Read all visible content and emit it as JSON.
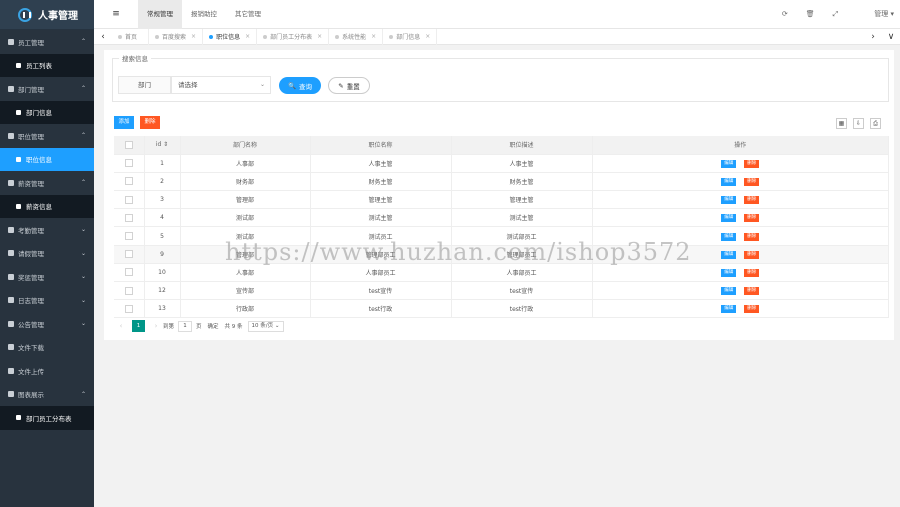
{
  "app": {
    "title": "人事管理"
  },
  "sidebar": {
    "items": [
      {
        "type": "group",
        "label": "员工管理",
        "icon": "users-icon",
        "chev": "^"
      },
      {
        "type": "sub",
        "label": "员工列表",
        "icon": "user-icon"
      },
      {
        "type": "group",
        "label": "部门管理",
        "icon": "org-icon",
        "chev": "^"
      },
      {
        "type": "sub",
        "label": "部门信息",
        "icon": "list-icon"
      },
      {
        "type": "group",
        "label": "职位管理",
        "icon": "bank-icon",
        "chev": "^"
      },
      {
        "type": "sub",
        "label": "职位信息",
        "icon": "list-icon",
        "active": true
      },
      {
        "type": "group",
        "label": "薪资管理",
        "icon": "money-icon",
        "chev": "^"
      },
      {
        "type": "sub",
        "label": "薪资信息",
        "icon": "list-icon"
      },
      {
        "type": "group",
        "label": "考勤管理",
        "icon": "car-icon",
        "chev": "v"
      },
      {
        "type": "group",
        "label": "请假管理",
        "icon": "bed-icon",
        "chev": "v"
      },
      {
        "type": "group",
        "label": "奖惩管理",
        "icon": "gear-icon",
        "chev": "v"
      },
      {
        "type": "group",
        "label": "日志管理",
        "icon": "gear-icon",
        "chev": "v"
      },
      {
        "type": "group",
        "label": "公告管理",
        "icon": "gear-icon",
        "chev": "v"
      },
      {
        "type": "group",
        "label": "文件下载",
        "icon": "cloud-download-icon",
        "chev": ""
      },
      {
        "type": "group",
        "label": "文件上传",
        "icon": "cloud-upload-icon",
        "chev": ""
      },
      {
        "type": "group",
        "label": "图表展示",
        "icon": "chart-icon",
        "chev": "^"
      },
      {
        "type": "sub",
        "label": "部门员工分布表",
        "icon": "bar-chart-icon"
      }
    ]
  },
  "topbar": {
    "toggle_icon": "≡",
    "menus": [
      "常规管理",
      "报销助控",
      "其它管理"
    ],
    "right": {
      "refresh": "⟳",
      "clear": "🗑",
      "fullscreen": "⤢",
      "user": "管理"
    }
  },
  "tabs": {
    "items": [
      {
        "label": "首页",
        "close": ""
      },
      {
        "label": "百度搜索",
        "close": "×"
      },
      {
        "label": "职位信息",
        "close": "×",
        "active": true
      },
      {
        "label": "部门员工分布表",
        "close": "×"
      },
      {
        "label": "系统性能",
        "close": "×"
      },
      {
        "label": "部门信息",
        "close": "×"
      }
    ],
    "left_arrow": "‹",
    "right_arrow": "›",
    "menu_arrow": "∨"
  },
  "search": {
    "legend": "搜索信息",
    "dept_label": "部门",
    "dept_placeholder": "请选择",
    "query_btn": "查询",
    "reset_btn": "重置"
  },
  "toolbar": {
    "add": "添加",
    "delete": "删除"
  },
  "table": {
    "headers": [
      "id ⇕",
      "部门名称",
      "职位名称",
      "职位描述",
      "操作"
    ],
    "edit_label": "编辑",
    "delete_label": "删除",
    "rows": [
      {
        "id": "1",
        "dept": "人事部",
        "pos": "人事主管",
        "desc": "人事主管"
      },
      {
        "id": "2",
        "dept": "财务部",
        "pos": "财务主管",
        "desc": "财务主管"
      },
      {
        "id": "3",
        "dept": "管理部",
        "pos": "管理主管",
        "desc": "管理主管"
      },
      {
        "id": "4",
        "dept": "测试部",
        "pos": "测试主管",
        "desc": "测试主管"
      },
      {
        "id": "5",
        "dept": "测试部",
        "pos": "测试员工",
        "desc": "测试部员工"
      },
      {
        "id": "9",
        "dept": "管理部",
        "pos": "管理部员工",
        "desc": "管理部员工"
      },
      {
        "id": "10",
        "dept": "人事部",
        "pos": "人事部员工",
        "desc": "人事部员工"
      },
      {
        "id": "12",
        "dept": "宣传部",
        "pos": "test宣传",
        "desc": "test宣传"
      },
      {
        "id": "13",
        "dept": "行政部",
        "pos": "test行政",
        "desc": "test行政"
      }
    ]
  },
  "pager": {
    "current": "1",
    "goto": "到第",
    "page_input": "1",
    "page_unit": "页",
    "confirm": "确定",
    "total": "共 9 条",
    "size": "10 条/页"
  },
  "watermark": "https://www.huzhan.com/ishop3572"
}
